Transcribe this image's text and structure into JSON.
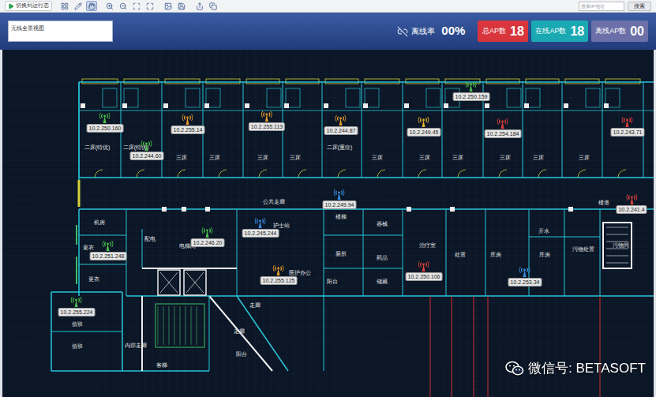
{
  "toolbar": {
    "run_button": "切换到运行态",
    "tools": [
      {
        "selected": false
      },
      {
        "selected": false
      },
      {
        "selected": true
      },
      {
        "selected": false
      },
      {
        "selected": false
      },
      {
        "selected": false
      },
      {
        "selected": false
      },
      {
        "selected": false
      },
      {
        "selected": false
      },
      {
        "selected": false
      },
      {
        "selected": false
      }
    ],
    "search": {
      "placeholder": "搜索IP地址"
    },
    "search_button": "搜索"
  },
  "view_title": "无线全景视图",
  "offline_rate": {
    "label": "离线率",
    "value": "00%"
  },
  "stats": [
    {
      "label": "总AP数",
      "value": "18",
      "color": "#d8363c"
    },
    {
      "label": "在线AP数",
      "value": "18",
      "color": "#1aa9b2"
    },
    {
      "label": "离线AP数",
      "value": "00",
      "color": "#6b70a8"
    }
  ],
  "rooms": [
    {
      "label": "二床(特优)"
    },
    {
      "label": "二床(特优)"
    },
    {
      "label": "三床"
    },
    {
      "label": "三床"
    },
    {
      "label": "三床"
    },
    {
      "label": "三床"
    },
    {
      "label": "二床(重症)"
    },
    {
      "label": "三床"
    },
    {
      "label": "三床"
    },
    {
      "label": "三床"
    },
    {
      "label": "三床"
    },
    {
      "label": "三床"
    },
    {
      "label": "三床"
    },
    {
      "label": "公共走廊"
    },
    {
      "label": "楼道"
    },
    {
      "label": "机房"
    },
    {
      "label": "配电"
    },
    {
      "label": "电梯间"
    },
    {
      "label": "护士站"
    },
    {
      "label": "楼梯"
    },
    {
      "label": "器械"
    },
    {
      "label": "治疗室"
    },
    {
      "label": "处置"
    },
    {
      "label": "库房"
    },
    {
      "label": "开水"
    },
    {
      "label": "库房"
    },
    {
      "label": "污物处置"
    },
    {
      "label": "污物间"
    },
    {
      "label": "更衣"
    },
    {
      "label": "更衣"
    },
    {
      "label": "厕所"
    },
    {
      "label": "药品"
    },
    {
      "label": "医护办公"
    },
    {
      "label": "阳台"
    },
    {
      "label": "储藏"
    },
    {
      "label": "值班"
    },
    {
      "label": "值班"
    },
    {
      "label": "内部走廊"
    },
    {
      "label": "走廊"
    },
    {
      "label": "走廊"
    },
    {
      "label": "阳台"
    },
    {
      "label": "客梯"
    }
  ],
  "aps": [
    {
      "ip": "10.2.250.160",
      "color": "#4cbf4a"
    },
    {
      "ip": "10.2.244.60",
      "color": "#4cbf4a"
    },
    {
      "ip": "10.2.255.14",
      "color": "#e59a2a"
    },
    {
      "ip": "10.2.255.113",
      "color": "#e59a2a"
    },
    {
      "ip": "10.2.244.87",
      "color": "#e59a2a"
    },
    {
      "ip": "10.2.249.45",
      "color": "#e5b52a"
    },
    {
      "ip": "10.2.250.159",
      "color": "#4cbf4a"
    },
    {
      "ip": "10.2.254.184",
      "color": "#e0403a"
    },
    {
      "ip": "10.2.243.71",
      "color": "#e0403a"
    },
    {
      "ip": "10.2.249.94",
      "color": "#3a8ee0"
    },
    {
      "ip": "10.2.241.4",
      "color": "#e0403a"
    },
    {
      "ip": "10.2.245.244",
      "color": "#3a8ee0"
    },
    {
      "ip": "10.2.246.20",
      "color": "#4cbf4a"
    },
    {
      "ip": "10.2.251.248",
      "color": "#4cbf4a"
    },
    {
      "ip": "10.2.255.125",
      "color": "#e59a2a"
    },
    {
      "ip": "10.2.250.106",
      "color": "#e0403a"
    },
    {
      "ip": "10.2.253.34",
      "color": "#3a8ee0"
    },
    {
      "ip": "10.2.255.224",
      "color": "#4cbf4a"
    }
  ],
  "watermark": "微信号: BETASOFT"
}
